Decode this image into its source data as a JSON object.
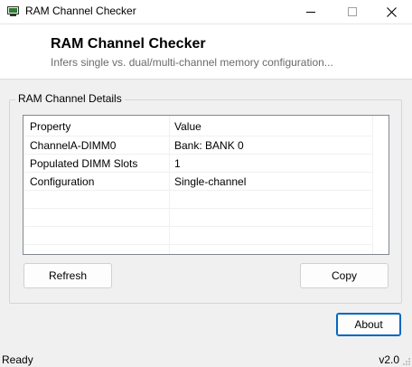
{
  "window": {
    "title": "RAM Channel Checker",
    "controls": [
      "minimize",
      "maximize",
      "close"
    ]
  },
  "header": {
    "title": "RAM Channel Checker",
    "subtitle": "Infers single vs. dual/multi-channel memory configuration..."
  },
  "group": {
    "label": "RAM Channel Details"
  },
  "table": {
    "columns": [
      "Property",
      "Value"
    ],
    "rows": [
      {
        "property": "ChannelA-DIMM0",
        "value": "Bank: BANK 0"
      },
      {
        "property": "Populated DIMM Slots",
        "value": "1"
      },
      {
        "property": "Configuration",
        "value": "Single-channel"
      }
    ]
  },
  "buttons": {
    "refresh": "Refresh",
    "copy": "Copy",
    "about": "About"
  },
  "status": {
    "text": "Ready",
    "version": "v2.0"
  },
  "colors": {
    "accent": "#0067c0",
    "window_bg": "#f0f0f0",
    "header_bg": "#ffffff"
  }
}
